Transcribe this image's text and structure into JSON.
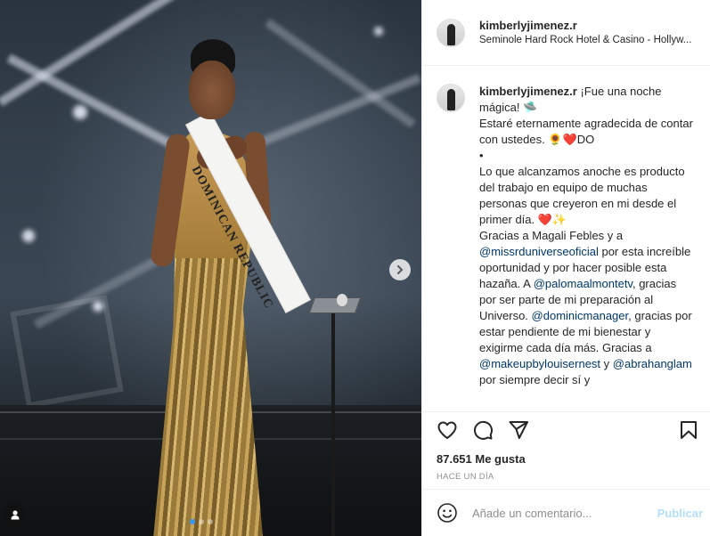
{
  "post": {
    "username": "kimberlyjimenez.r",
    "location": "Seminole Hard Rock Hotel & Casino - Hollyw...",
    "media": {
      "sash_text": "DOMINICAN REPUBLIC",
      "carousel_position": 1,
      "carousel_count": 3,
      "next_icon": "chevron-right-icon",
      "user_tag_icon": "person-icon"
    }
  },
  "caption": {
    "username": "kimberlyjimenez.r",
    "line1": "¡Fue una noche mágica! 🛸",
    "line2": "Estaré eternamente agradecida de contar con ustedes. 🌻❤️DO",
    "line3": "•",
    "line4": "Lo que alcanzamos anoche es producto del trabajo en equipo de muchas personas que creyeron en mi desde el primer día. ❤️✨",
    "line5_a": "Gracias a Magali Febles y a ",
    "mention1": "@missrduniverseoficial",
    "line5_b": " por esta increíble oportunidad y por hacer posible esta hazaña. A ",
    "mention2": "@palomaalmontetv",
    "line5_c": ", gracias por ser parte de mi preparación al Universo. ",
    "mention3": "@dominicmanager",
    "line5_d": ", gracias por estar pendiente de mi bienestar y exigirme cada día más. Gracias a ",
    "mention4": "@makeupbylouisernest",
    "line5_e": " y ",
    "mention5": "@abrahanglam",
    "line5_f": " por siempre decir sí y"
  },
  "actions": {
    "like_icon": "heart-icon",
    "comment_icon": "comment-icon",
    "share_icon": "send-icon",
    "save_icon": "bookmark-icon"
  },
  "likes_text": "87.651 Me gusta",
  "timestamp": "HACE UN DÍA",
  "comment_box": {
    "placeholder": "Añade un comentario...",
    "post_label": "Publicar",
    "emoji_icon": "smiley-icon"
  },
  "colors": {
    "link": "#00376b",
    "post_button_disabled": "#b2dffc",
    "carousel_active_dot": "#3897f0"
  }
}
